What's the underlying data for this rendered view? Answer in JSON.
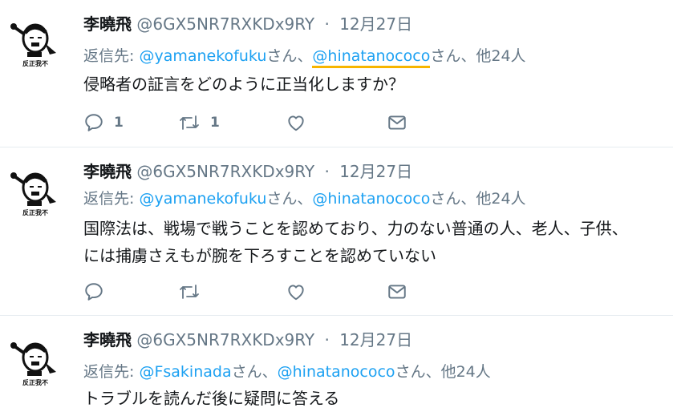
{
  "tweets": [
    {
      "name": "李曉飛",
      "handle": "@6GX5NR7RXKDx9RY",
      "separator": "·",
      "date": "12月27日",
      "reply_prefix": "返信先: ",
      "mentions": [
        "@yamanekofuku",
        "@hinatanococo"
      ],
      "mention_suffix": "さん",
      "mention_joiner": "、",
      "others": "他24人",
      "text_lines": [
        "侵略者の証言をどのように正当化しますか？"
      ],
      "reply_count": "1",
      "retweet_count": "1"
    },
    {
      "name": "李曉飛",
      "handle": "@6GX5NR7RXKDx9RY",
      "separator": "·",
      "date": "12月27日",
      "reply_prefix": "返信先: ",
      "mentions": [
        "@yamanekofuku",
        "@hinatanococo"
      ],
      "mention_suffix": "さん",
      "mention_joiner": "、",
      "others": "他24人",
      "text_lines": [
        "国際法は、戦場で戦うことを認めており、力のない普通の人、老人、子供、",
        "には捕虜さえもが腕を下ろすことを認めていない"
      ],
      "reply_count": "",
      "retweet_count": ""
    },
    {
      "name": "李曉飛",
      "handle": "@6GX5NR7RXKDx9RY",
      "separator": "·",
      "date": "12月27日",
      "reply_prefix": "返信先: ",
      "mentions": [
        "@Fsakinada",
        "@hinatanococo"
      ],
      "mention_suffix": "さん",
      "mention_joiner": "、",
      "others": "他24人",
      "text_lines": [
        "トラブルを読んだ後に疑問に答える"
      ]
    }
  ],
  "avatar": {
    "caption": "反正我不"
  },
  "colors": {
    "link": "#1da1f2",
    "secondary": "#657786",
    "underline_highlight": "#f7b500",
    "divider": "#e6ecf0"
  },
  "icons": [
    "reply-icon",
    "retweet-icon",
    "like-icon",
    "direct-message-icon"
  ]
}
